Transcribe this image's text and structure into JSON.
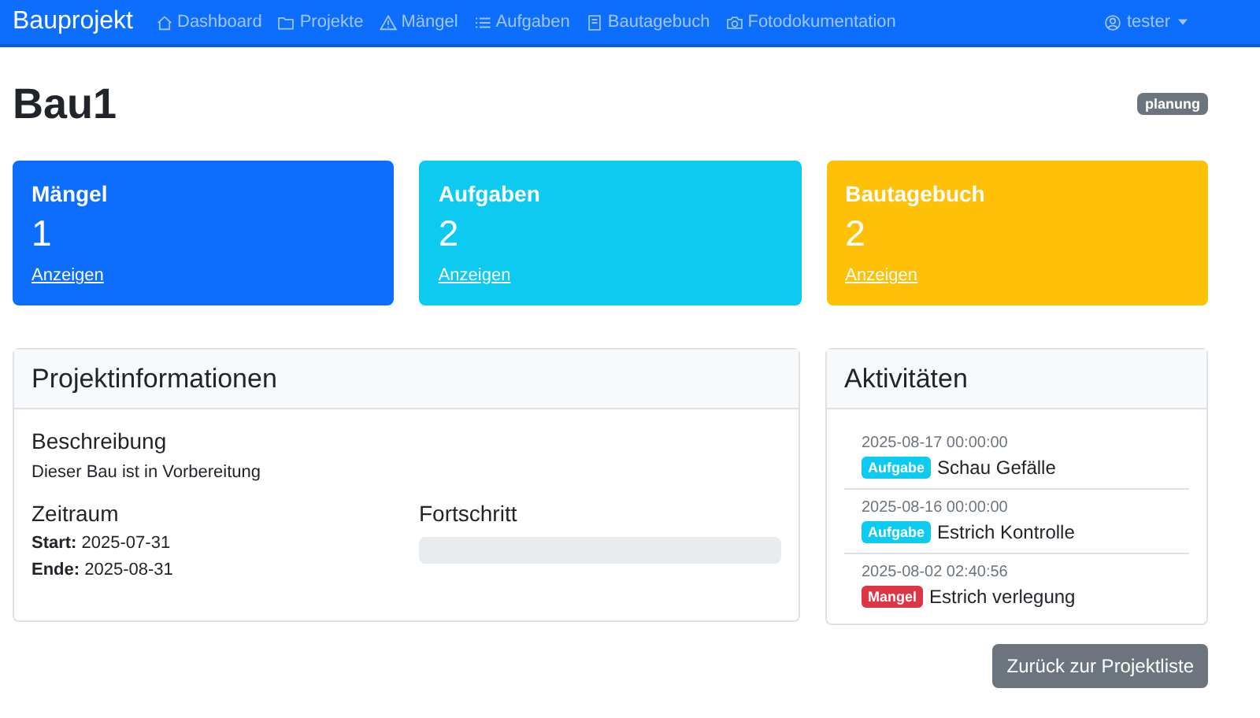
{
  "navbar": {
    "brand": "Bauprojekt",
    "items": [
      {
        "label": "Dashboard",
        "kind": "house"
      },
      {
        "label": "Projekte",
        "kind": "folder"
      },
      {
        "label": "Mängel",
        "kind": "warning"
      },
      {
        "label": "Aufgaben",
        "kind": "list"
      },
      {
        "label": "Bautagebuch",
        "kind": "journal"
      },
      {
        "label": "Fotodokumentation",
        "kind": "camera"
      }
    ],
    "user": "tester"
  },
  "title": "Bau1",
  "status": "planung",
  "stats": [
    {
      "kind": "primary",
      "title": "Mängel",
      "count": "1",
      "link": "Anzeigen"
    },
    {
      "kind": "info",
      "title": "Aufgaben",
      "count": "2",
      "link": "Anzeigen"
    },
    {
      "kind": "warning",
      "title": "Bautagebuch",
      "count": "2",
      "link": "Anzeigen"
    }
  ],
  "info": {
    "title": "Projektinformationen",
    "description_heading": "Beschreibung",
    "description": "Dieser Bau ist in Vorbereitung",
    "period_heading": "Zeitraum",
    "start_label": "Start:",
    "start": "2025-07-31",
    "end_label": "Ende:",
    "end": "2025-08-31",
    "progress_heading": "Fortschritt",
    "progress": {
      "level": 0
    }
  },
  "activities": {
    "title": "Aktivitäten",
    "items": [
      {
        "time": "2025-08-17 00:00:00",
        "badge": "Aufgabe",
        "kind": "task",
        "text": "Schau Gefälle"
      },
      {
        "time": "2025-08-16 00:00:00",
        "badge": "Aufgabe",
        "kind": "task",
        "text": "Estrich Kontrolle"
      },
      {
        "time": "2025-08-02 02:40:56",
        "badge": "Mangel",
        "kind": "defect",
        "text": "Estrich verlegung"
      }
    ]
  },
  "back_button": "Zurück zur Projektliste"
}
